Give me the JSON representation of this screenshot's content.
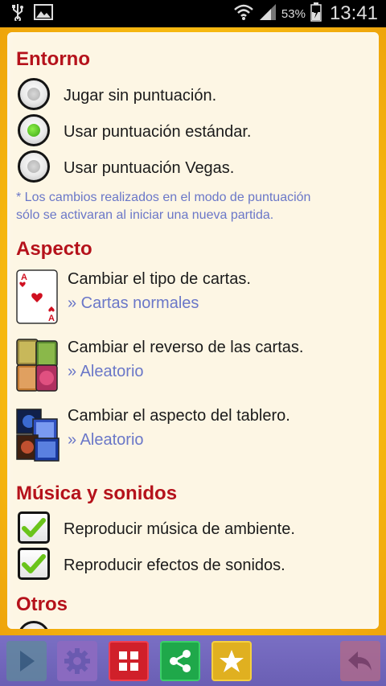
{
  "status_bar": {
    "battery_percent": "53%",
    "time": "13:41",
    "icons": [
      "usb-icon",
      "image-icon",
      "wifi-icon",
      "signal-icon",
      "battery-icon"
    ]
  },
  "sections": {
    "entorno": {
      "title": "Entorno",
      "options": [
        {
          "label": "Jugar sin puntuación.",
          "selected": false
        },
        {
          "label": "Usar puntuación estándar.",
          "selected": true
        },
        {
          "label": "Usar puntuación Vegas.",
          "selected": false
        }
      ],
      "note_line1": "* Los cambios realizados en el modo de puntuación",
      "note_line2": "sólo se activaran al iniciar una nueva partida."
    },
    "aspecto": {
      "title": "Aspecto",
      "items": [
        {
          "label": "Cambiar el tipo de cartas.",
          "value": "» Cartas normales"
        },
        {
          "label": "Cambiar el reverso de las cartas.",
          "value": "» Aleatorio"
        },
        {
          "label": "Cambiar el aspecto del tablero.",
          "value": "» Aleatorio"
        }
      ]
    },
    "musica": {
      "title": "Música y sonidos",
      "options": [
        {
          "label": "Reproducir música de ambiente.",
          "checked": true
        },
        {
          "label": "Reproducir efectos de sonidos.",
          "checked": true
        }
      ]
    },
    "otros": {
      "title": "Otros"
    }
  },
  "bottom_bar": {
    "buttons": [
      "play-icon",
      "settings-icon",
      "grid-icon",
      "share-icon",
      "star-icon",
      "back-icon"
    ]
  },
  "colors": {
    "accent_red": "#b5121b",
    "link_blue": "#6a77c8",
    "frame_yellow": "#f6b810",
    "bar_purple": "#7a6fc4"
  }
}
